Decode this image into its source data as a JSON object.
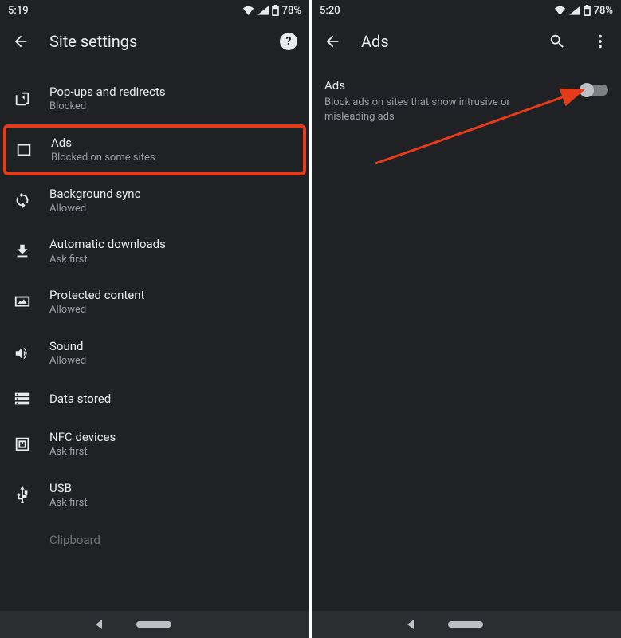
{
  "left": {
    "status": {
      "time": "5:19",
      "battery": "78%"
    },
    "title": "Site settings",
    "items": [
      {
        "title": "Pop-ups and redirects",
        "sub": "Blocked"
      },
      {
        "title": "Ads",
        "sub": "Blocked on some sites"
      },
      {
        "title": "Background sync",
        "sub": "Allowed"
      },
      {
        "title": "Automatic downloads",
        "sub": "Ask first"
      },
      {
        "title": "Protected content",
        "sub": "Allowed"
      },
      {
        "title": "Sound",
        "sub": "Allowed"
      },
      {
        "title": "Data stored",
        "sub": ""
      },
      {
        "title": "NFC devices",
        "sub": "Ask first"
      },
      {
        "title": "USB",
        "sub": "Ask first"
      },
      {
        "title": "Clipboard",
        "sub": ""
      }
    ]
  },
  "right": {
    "status": {
      "time": "5:20",
      "battery": "78%"
    },
    "title": "Ads",
    "detail": {
      "heading": "Ads",
      "description": "Block ads on sites that show intrusive or misleading ads"
    }
  },
  "annotation_color": "#e53b1a"
}
